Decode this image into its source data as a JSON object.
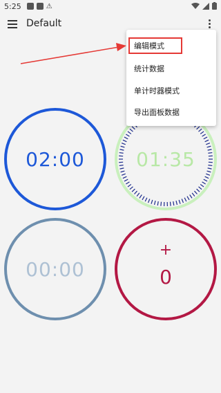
{
  "status_bar": {
    "time": "5:25",
    "left_icons": [
      "app-icon",
      "app-icon",
      "notification-icon"
    ],
    "right_icons": [
      "wifi-icon",
      "signal-icon",
      "battery-icon"
    ]
  },
  "app_bar": {
    "title": "Default",
    "menu_icon": "menu-icon",
    "overflow_icon": "more-vert-icon"
  },
  "overflow_menu": {
    "items": [
      {
        "label": "编辑模式"
      },
      {
        "label": "统计数据"
      },
      {
        "label": "单计时器模式"
      },
      {
        "label": "导出面板数据"
      }
    ]
  },
  "timers": [
    {
      "value": "02:00",
      "color": "#1d58d8"
    },
    {
      "value": "01:35",
      "color": "#b8e8a6",
      "tick_color": "#1a2a8a"
    },
    {
      "value": "00:00",
      "color": "#6e8fae"
    },
    {
      "plus": "+",
      "value": "0",
      "color": "#b31844"
    }
  ],
  "annotation": {
    "highlight_color": "#e53935"
  }
}
